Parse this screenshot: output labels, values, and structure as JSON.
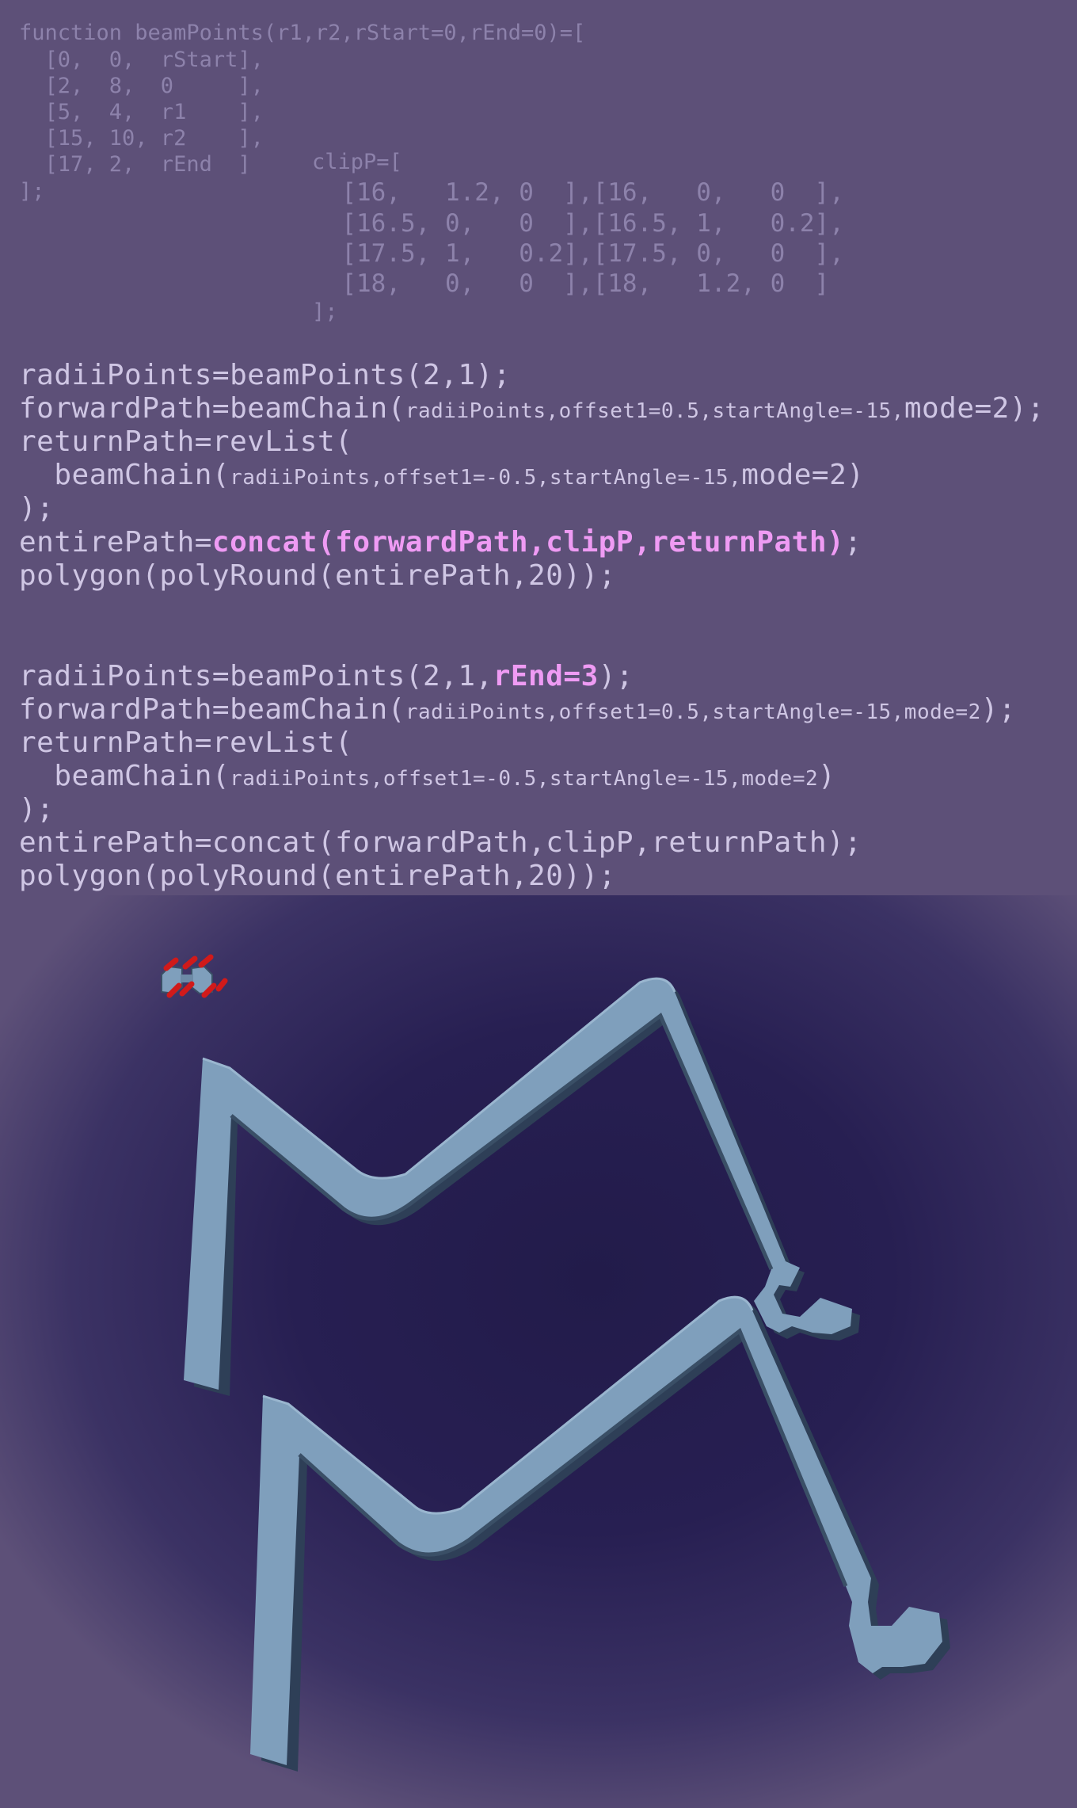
{
  "code": {
    "beam_points_fn": [
      "function beamPoints(r1,r2,rStart=0,rEnd=0)=[",
      "  [0,  0,  rStart],",
      "  [2,  8,  0     ],",
      "  [5,  4,  r1    ],",
      "  [15, 10, r2    ],",
      "  [17, 2,  rEnd  ]",
      "];"
    ],
    "clip_points": [
      "clipP=[",
      "  [16,   1.2, 0  ],[16,   0,   0  ],",
      "  [16.5, 0,   0  ],[16.5, 1,   0.2],",
      "  [17.5, 1,   0.2],[17.5, 0,   0  ],",
      "  [18,   0,   0  ],[18,   1.2, 0  ]",
      "];"
    ],
    "block1": {
      "radii": "radiiPoints=beamPoints(2,1);",
      "forward_pre": "forwardPath=beamChain(",
      "forward_args": "radiiPoints,offset1=0.5,startAngle=-15,",
      "forward_mode": "mode=2);",
      "return_open": "returnPath=revList(",
      "chain_pre": "  beamChain(",
      "chain_args": "radiiPoints,offset1=-0.5,startAngle=-15,",
      "chain_mode": "mode=2)",
      "close": ");",
      "entire_pre": "entirePath=",
      "entire_hl": "concat(forwardPath,clipP,returnPath)",
      "entire_post": ";",
      "polygon": "polygon(polyRound(entirePath,20));"
    },
    "block2": {
      "radii_pre": "radiiPoints=beamPoints(2,1,",
      "radii_hl": "rEnd=3",
      "radii_post": ");",
      "forward_pre": "forwardPath=beamChain(",
      "forward_args": "radiiPoints,offset1=0.5,startAngle=-15,mode=2",
      "forward_post": ");",
      "return_open": "returnPath=revList(",
      "chain_pre": "  beamChain(",
      "chain_args": "radiiPoints,offset1=-0.5,startAngle=-15,mode=2",
      "chain_post": ")",
      "close": ");",
      "entire": "entirePath=concat(forwardPath,clipP,returnPath);",
      "polygon": "polygon(polyRound(entirePath,20));"
    }
  },
  "viewport": {
    "background_center": "#241d4c",
    "background_edge": "#5d5078",
    "part_color": "#7f9fbc",
    "part_shadow": "#3a4f66",
    "axis_color": "#d11a1a",
    "axis_icon": "view-axes-gizmo-icon",
    "models": [
      "beam-part-default-rend",
      "beam-part-rend-3"
    ]
  },
  "colors": {
    "background": "#5d5078",
    "code_text": "#cfc6e4",
    "code_dim": "#8d82ab",
    "highlight": "#ef9bf4"
  }
}
